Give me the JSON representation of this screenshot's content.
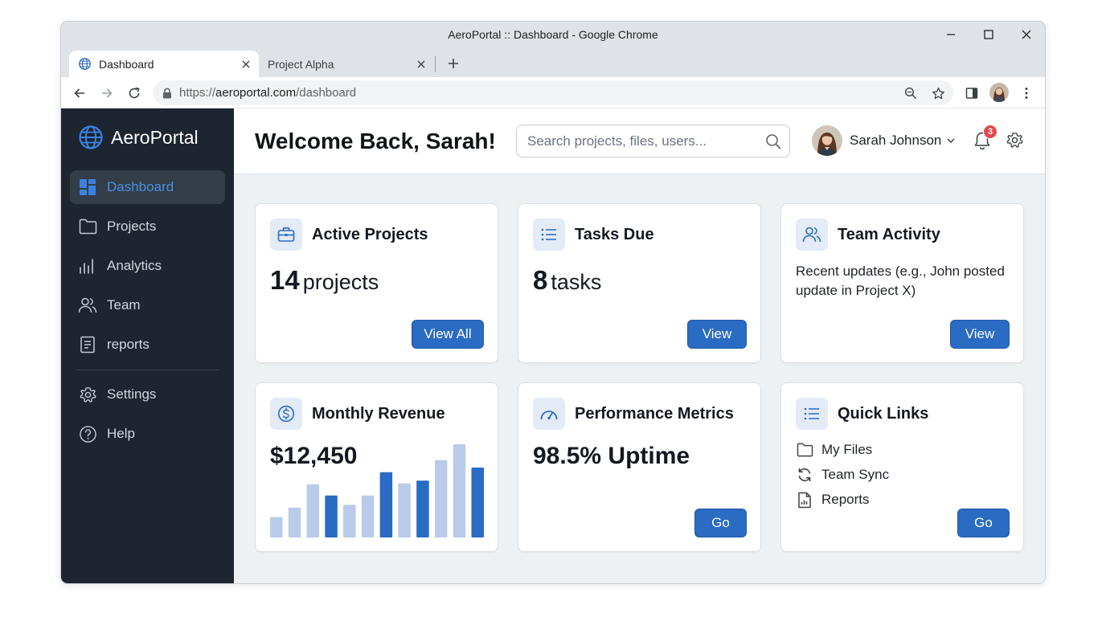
{
  "window": {
    "title": "AeroPortal :: Dashboard - Google Chrome"
  },
  "tabs": [
    {
      "label": "Dashboard",
      "active": true
    },
    {
      "label": "Project Alpha",
      "active": false
    }
  ],
  "address": {
    "scheme": "https://",
    "host": "aeroportal.com",
    "path": "/dashboard"
  },
  "sidebar": {
    "brand": "AeroPortal",
    "items": [
      {
        "label": "Dashboard",
        "icon": "dashboard-icon",
        "active": true
      },
      {
        "label": "Projects",
        "icon": "folder-icon"
      },
      {
        "label": "Analytics",
        "icon": "bar-chart-icon"
      },
      {
        "label": "Team",
        "icon": "team-icon"
      },
      {
        "label": "reports",
        "icon": "document-icon"
      }
    ],
    "footer_items": [
      {
        "label": "Settings",
        "icon": "gear-icon"
      },
      {
        "label": "Help",
        "icon": "help-icon"
      }
    ]
  },
  "header": {
    "title": "Welcome Back, Sarah!",
    "search_placeholder": "Search projects, files, users...",
    "user_name": "Sarah Johnson",
    "notification_count": "3"
  },
  "cards": {
    "active_projects": {
      "title": "Active Projects",
      "value": "14",
      "unit": "projects",
      "button": "View All"
    },
    "tasks_due": {
      "title": "Tasks Due",
      "value": "8",
      "unit": "tasks",
      "button": "View"
    },
    "team_activity": {
      "title": "Team Activity",
      "description": "Recent updates (e.g., John posted update in Project X)",
      "button": "View"
    },
    "monthly_revenue": {
      "title": "Monthly Revenue",
      "value": "$12,450"
    },
    "performance": {
      "title": "Performance Metrics",
      "value": "98.5% Uptime",
      "button": "Go"
    },
    "quick_links": {
      "title": "Quick Links",
      "links": [
        {
          "label": "My Files",
          "icon": "folder-icon"
        },
        {
          "label": "Team Sync",
          "icon": "sync-icon"
        },
        {
          "label": "Reports",
          "icon": "report-file-icon"
        }
      ],
      "button": "Go"
    }
  },
  "chart_data": {
    "type": "bar",
    "values": [
      2.2,
      3.2,
      5.7,
      4.5,
      3.5,
      4.5,
      7.0,
      5.8,
      6.1,
      8.3,
      10.0,
      7.5
    ],
    "highlighted": [
      false,
      false,
      false,
      true,
      false,
      false,
      true,
      false,
      true,
      false,
      false,
      true
    ],
    "ylim": [
      0,
      10
    ],
    "colors": {
      "highlight": "#2a6bc3",
      "muted": "#b9cbe8"
    }
  },
  "colors": {
    "accent": "#2a6bc3",
    "sidebar_bg": "#1c2530",
    "sidebar_active_text": "#4a8fe0",
    "badge": "#e5484d"
  }
}
